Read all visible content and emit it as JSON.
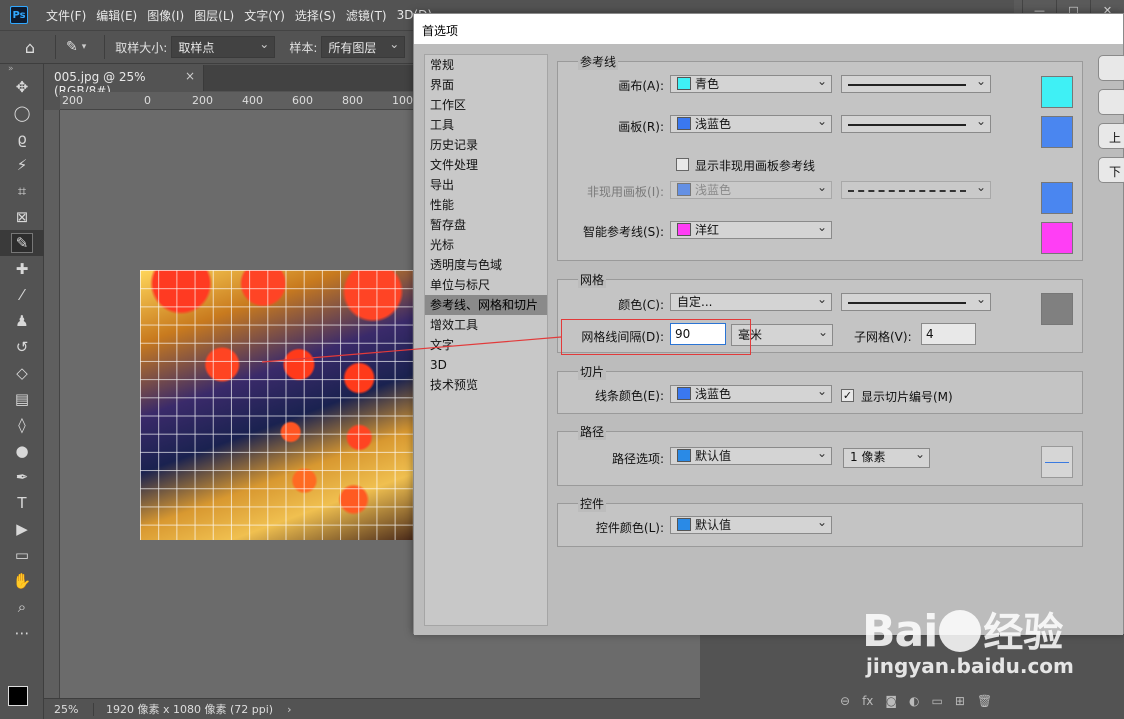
{
  "app": {
    "logo": "Ps"
  },
  "menubar": {
    "items": [
      "文件(F)",
      "编辑(E)",
      "图像(I)",
      "图层(L)",
      "文字(Y)",
      "选择(S)",
      "滤镜(T)",
      "3D(D)"
    ]
  },
  "optbar": {
    "sample_size_label": "取样大小:",
    "sample_size_value": "取样点",
    "sample_label": "样本:",
    "sample_value": "所有图层"
  },
  "document": {
    "tab_title": "005.jpg @ 25%(RGB/8#)",
    "close": "×"
  },
  "ruler": {
    "ticks": [
      "200",
      "0",
      "200",
      "400",
      "600",
      "800",
      "100"
    ]
  },
  "status": {
    "zoom": "25%",
    "doc_info": "1920 像素 x 1080 像素 (72 ppi)",
    "caret": "›"
  },
  "dialog": {
    "title": "首选项",
    "nav": [
      "常规",
      "界面",
      "工作区",
      "工具",
      "历史记录",
      "文件处理",
      "导出",
      "性能",
      "暂存盘",
      "光标",
      "透明度与色域",
      "单位与标尺",
      "参考线、网格和切片",
      "增效工具",
      "文字",
      "3D",
      "技术预览"
    ],
    "nav_active_index": 12,
    "guides": {
      "title": "参考线",
      "canvas_label": "画布(A):",
      "canvas_color": "青色",
      "canvas_color_hex": "#3ff0f5",
      "artboard_label": "画板(R):",
      "artboard_color": "浅蓝色",
      "artboard_color_hex": "#3a78f0",
      "show_inactive_label": "显示非现用画板参考线",
      "show_inactive_checked": false,
      "inactive_label": "非现用画板(I):",
      "inactive_color": "浅蓝色",
      "inactive_color_hex": "#3a78f0",
      "smart_label": "智能参考线(S):",
      "smart_color": "洋红",
      "smart_color_hex": "#ff3ef5"
    },
    "grid": {
      "title": "网格",
      "color_label": "颜色(C):",
      "color_value": "自定...",
      "color_hex": "#808080",
      "spacing_label": "网格线间隔(D):",
      "spacing_value": "90",
      "unit_value": "毫米",
      "subdiv_label": "子网格(V):",
      "subdiv_value": "4"
    },
    "slices": {
      "title": "切片",
      "line_color_label": "线条颜色(E):",
      "line_color": "浅蓝色",
      "line_color_hex": "#3a78f0",
      "show_numbers_label": "显示切片编号(M)",
      "show_numbers_checked": true
    },
    "path": {
      "title": "路径",
      "options_label": "路径选项:",
      "options_color": "默认值",
      "options_color_hex": "#2a8ae6",
      "width_value": "1 像素"
    },
    "controls": {
      "title": "控件",
      "color_label": "控件颜色(L):",
      "color_value": "默认值",
      "color_hex": "#2a8ae6"
    },
    "side_buttons": [
      "上",
      "下"
    ]
  },
  "watermark": {
    "brand": "Bai",
    "brand2": "经验",
    "sub": "jingyan.baidu.com"
  },
  "colors": {
    "highlight": "#e23a3a"
  }
}
